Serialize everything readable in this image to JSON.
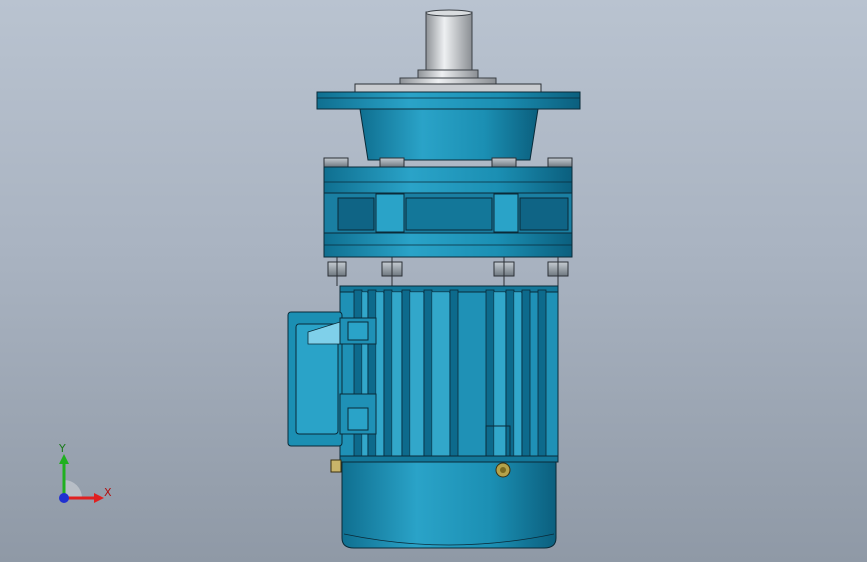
{
  "viewport": {
    "background_top": "#b9c3d0",
    "background_bottom": "#8f99a6"
  },
  "model": {
    "body_color": "#1b8fb3",
    "body_dark": "#0b5f7e",
    "body_light": "#3fb6d8",
    "shaft_color": "#c9ccd0",
    "bolt_color": "#9aa3ab",
    "outline_color": "#0a2a38"
  },
  "triad": {
    "x_label": "X",
    "y_label": "Y",
    "x_color": "#e02020",
    "y_color": "#20b020",
    "z_color": "#2030d0"
  }
}
